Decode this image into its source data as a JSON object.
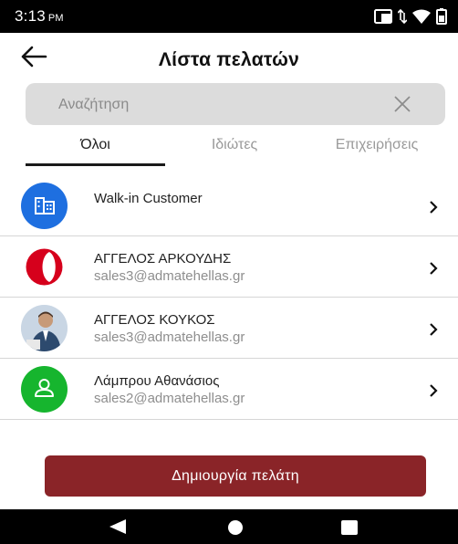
{
  "status_bar": {
    "time": "3:13",
    "ampm": "PM",
    "icons": [
      "cast-icon",
      "data-arrows-icon",
      "wifi-icon",
      "battery-icon"
    ]
  },
  "header": {
    "title": "Λίστα πελατών",
    "back_icon": "arrow-left-icon"
  },
  "search": {
    "placeholder": "Αναζήτηση",
    "value": "",
    "clear_icon": "close-icon"
  },
  "tabs": [
    {
      "label": "Όλοι",
      "active": true
    },
    {
      "label": "Ιδιώτες",
      "active": false
    },
    {
      "label": "Επιχειρήσεις",
      "active": false
    }
  ],
  "customers": [
    {
      "name": "Walk-in Customer",
      "email": "",
      "avatar": "building-icon",
      "avatar_color": "#1e6fe0"
    },
    {
      "name": "ΑΓΓΕΛΟΣ ΑΡΚΟΥΔΗΣ",
      "email": "sales3@admatehellas.gr",
      "avatar": "turkish-airlines-logo",
      "avatar_color": "#d6001c"
    },
    {
      "name": "ΑΓΓΕΛΟΣ ΚΟΥΚΟΣ",
      "email": "sales3@admatehellas.gr",
      "avatar": "person-photo",
      "avatar_color": "#5c7a9c"
    },
    {
      "name": "Λάμπρου Αθανάσιος",
      "email": "sales2@admatehellas.gr",
      "avatar": "person-icon",
      "avatar_color": "#16b52e"
    }
  ],
  "create_button": {
    "label": "Δημιουργία πελάτη",
    "color": "#8a2428"
  },
  "nav_bar": {
    "buttons": [
      "back-triangle-icon",
      "home-circle-icon",
      "recents-square-icon"
    ]
  }
}
